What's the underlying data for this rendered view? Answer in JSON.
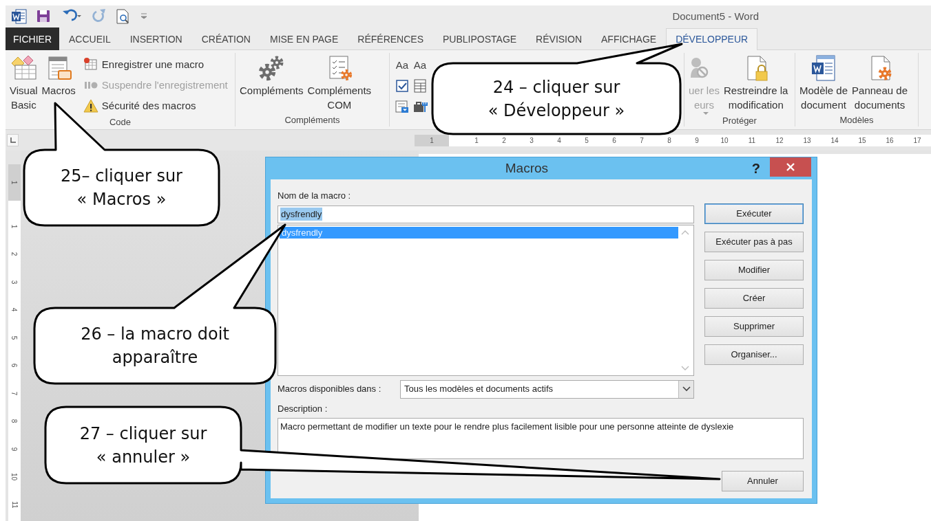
{
  "window": {
    "title": "Document5 - Word"
  },
  "quick_access": [
    {
      "kind": "app",
      "disabled": false
    },
    {
      "kind": "save",
      "disabled": false
    },
    {
      "kind": "undo",
      "disabled": false
    },
    {
      "kind": "redo",
      "disabled": true
    },
    {
      "kind": "preview",
      "disabled": false
    },
    {
      "kind": "customize",
      "disabled": false
    }
  ],
  "tabs": [
    {
      "label": "FICHIER",
      "kind": "file",
      "selected": false
    },
    {
      "label": "ACCUEIL",
      "kind": "tab",
      "selected": false
    },
    {
      "label": "INSERTION",
      "kind": "tab",
      "selected": false
    },
    {
      "label": "CRÉATION",
      "kind": "tab",
      "selected": false
    },
    {
      "label": "MISE EN PAGE",
      "kind": "tab",
      "selected": false
    },
    {
      "label": "RÉFÉRENCES",
      "kind": "tab",
      "selected": false
    },
    {
      "label": "PUBLIPOSTAGE",
      "kind": "tab",
      "selected": false
    },
    {
      "label": "RÉVISION",
      "kind": "tab",
      "selected": false
    },
    {
      "label": "AFFICHAGE",
      "kind": "tab",
      "selected": false
    },
    {
      "label": "DÉVELOPPEUR",
      "kind": "tab",
      "selected": true
    }
  ],
  "ribbon_groups": [
    {
      "label": "Code",
      "large_buttons": [
        {
          "label": "Visual\nBasic",
          "disabled": false
        },
        {
          "label": "Macros",
          "disabled": false
        }
      ],
      "small_buttons": [
        {
          "label": "Enregistrer une macro",
          "disabled": false
        },
        {
          "label": "Suspendre l'enregistrement",
          "disabled": true
        },
        {
          "label": "Sécurité des macros",
          "disabled": false
        }
      ]
    },
    {
      "label": "Compléments",
      "large_buttons": [
        {
          "label": "Compléments",
          "disabled": false
        },
        {
          "label": "Compléments\nCOM",
          "disabled": false
        }
      ]
    },
    {
      "controls": [
        {
          "label": "Aa",
          "kind": "text"
        },
        {
          "label": "Aa",
          "kind": "text"
        },
        {
          "kind": "checkbox"
        },
        {
          "kind": "table"
        },
        {
          "kind": "dropdown"
        },
        {
          "kind": "toolbox"
        }
      ]
    },
    {
      "label": "Protéger",
      "large_buttons": [
        {
          "label": "uer les\neurs",
          "disabled": true,
          "dropdown": true
        },
        {
          "label": "Restreindre la\nmodification",
          "disabled": false
        }
      ]
    },
    {
      "label": "Modèles",
      "large_buttons": [
        {
          "label": "Modèle de\ndocument",
          "disabled": false
        },
        {
          "label": "Panneau de\ndocuments",
          "disabled": false
        }
      ]
    }
  ],
  "ruler": {
    "horizontal": [
      "1",
      "1",
      "2",
      "3",
      "4",
      "5",
      "6",
      "7",
      "8",
      "9",
      "10",
      "11",
      "12",
      "13",
      "14",
      "15",
      "16",
      "17"
    ],
    "vertical": [
      "1",
      "1",
      "2",
      "3",
      "4",
      "5",
      "6",
      "7",
      "8",
      "9",
      "10",
      "11"
    ]
  },
  "dialog": {
    "title": "Macros",
    "help": "?",
    "name_label": {
      "text": "Nom de la macro :"
    },
    "name_value": "dysfrendly",
    "name_value_selected": true,
    "macros": [
      {
        "name": "dysfrendly",
        "selected": true
      }
    ],
    "buttons": [
      {
        "label": "Exécuter",
        "default": true
      },
      {
        "label": "Exécuter pas à pas",
        "default": false
      },
      {
        "label": "Modifier",
        "default": false
      },
      {
        "label": "Créer",
        "default": false
      },
      {
        "label": "Supprimer",
        "default": false
      },
      {
        "label": "Organiser...",
        "default": false
      }
    ],
    "available_in": {
      "label": "Macros disponibles dans :",
      "value": "Tous les modèles et documents actifs"
    },
    "description": {
      "label": "Description :",
      "value": "Macro permettant de modifier un texte pour le rendre plus facilement lisible pour une personne atteinte de dyslexie"
    },
    "cancel": {
      "label": "Annuler"
    }
  },
  "callouts": [
    {
      "text": "24 – cliquer sur\n« Développeur »"
    },
    {
      "text": "25– cliquer sur\n« Macros »"
    },
    {
      "text": "26 – la macro doit\napparaître"
    },
    {
      "text": "27 – cliquer sur\n« annuler »"
    }
  ]
}
